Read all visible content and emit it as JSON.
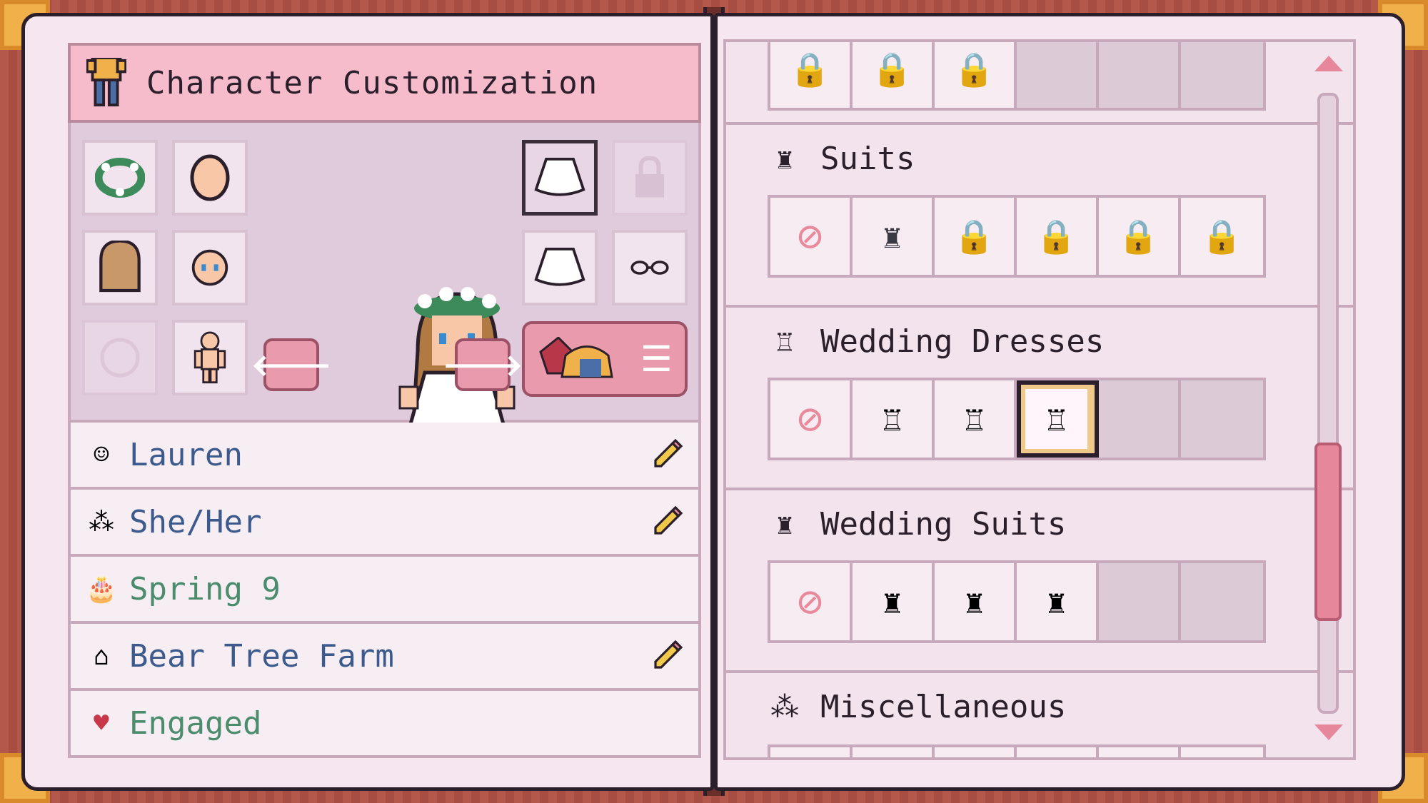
{
  "header": {
    "title": "Character Customization",
    "icon": "shirt-icon"
  },
  "customization": {
    "left_slots": [
      {
        "name": "flower-crown-slot",
        "icon": "wreath-icon"
      },
      {
        "name": "head-shape-slot",
        "icon": "head-icon"
      },
      {
        "name": "hair-slot",
        "icon": "hair-icon"
      },
      {
        "name": "face-slot",
        "icon": "face-icon"
      },
      {
        "name": "empty-accessory-slot",
        "icon": "blank-icon"
      },
      {
        "name": "body-slot",
        "icon": "body-icon"
      }
    ],
    "right_slots": [
      {
        "name": "dress-slot-selected",
        "icon": "wedding-dress-icon"
      },
      {
        "name": "locked-slot",
        "icon": "lock-icon"
      },
      {
        "name": "dress-slot",
        "icon": "wedding-dress-icon"
      },
      {
        "name": "glasses-slot",
        "icon": "glasses-icon"
      }
    ],
    "prev_arrow": "🡐",
    "next_arrow": "🡒",
    "menu_lines": "☰"
  },
  "info": {
    "name": "Lauren",
    "pronouns": "She/Her",
    "birthday": "Spring 9",
    "farm": "Bear Tree Farm",
    "status": "Engaged"
  },
  "sections": {
    "suits_title": "Suits",
    "wedding_dresses_title": "Wedding Dresses",
    "wedding_suits_title": "Wedding Suits",
    "misc_title": "Miscellaneous"
  },
  "colors": {
    "accent_pink": "#e99aac",
    "header_pink": "#f6bccb",
    "name_blue": "#3c5a8c",
    "status_green": "#4a8c6c",
    "selected_gold": "#f0c98a"
  }
}
